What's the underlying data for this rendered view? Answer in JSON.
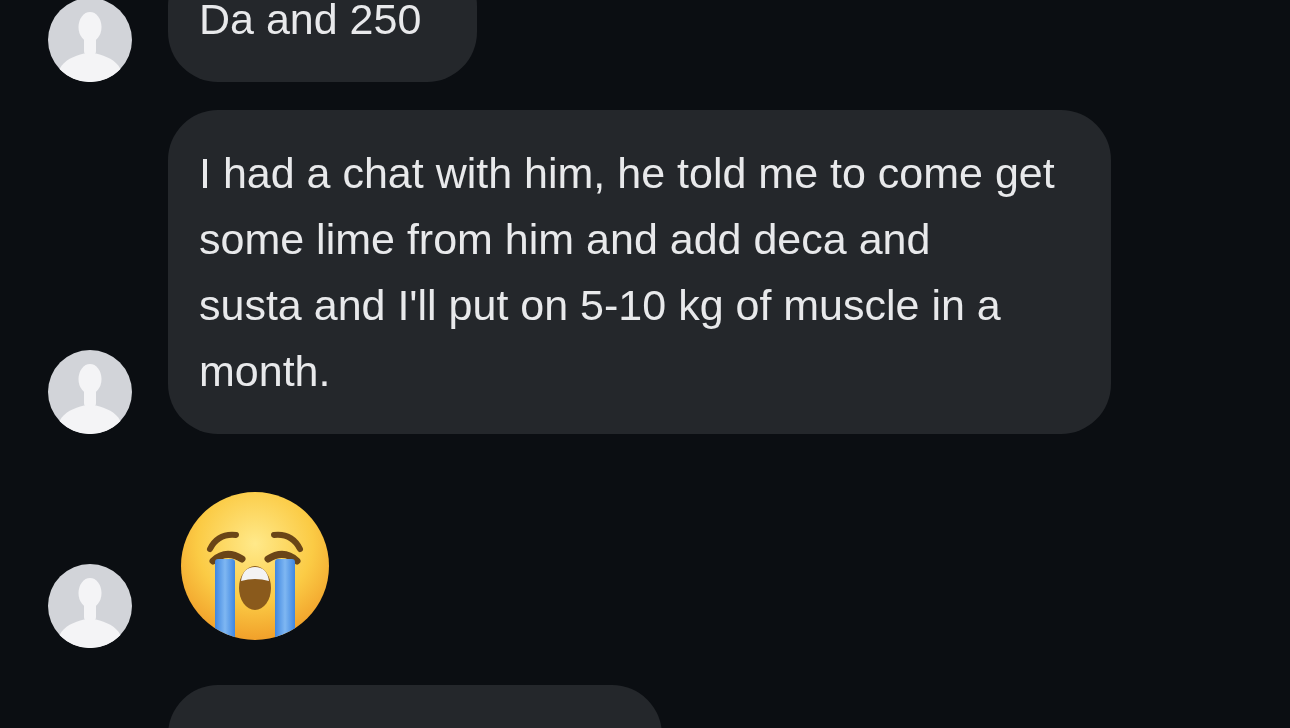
{
  "messages": [
    {
      "kind": "text",
      "avatar": true,
      "text": "Da and 250"
    },
    {
      "kind": "text",
      "avatar": true,
      "text": "I had a chat with him, he told me to come get\nsome lime from him and add deca and\nsusta and I'll put on 5-10 kg of muscle in a\nmonth."
    },
    {
      "kind": "emoji",
      "avatar": true
    },
    {
      "kind": "text",
      "avatar": false
    }
  ]
}
